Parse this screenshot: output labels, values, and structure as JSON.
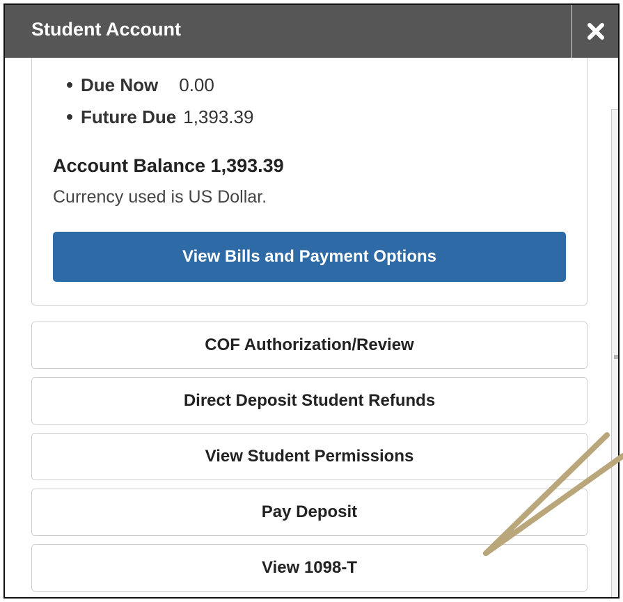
{
  "header": {
    "title": "Student Account",
    "close_icon": "close-icon"
  },
  "summary": {
    "items": [
      {
        "label": "Due Now",
        "value": "0.00"
      },
      {
        "label": "Future Due",
        "value": "1,393.39"
      }
    ],
    "account_balance": "Account Balance 1,393.39",
    "currency_note": "Currency used is US Dollar.",
    "primary_button": "View Bills and Payment Options"
  },
  "actions": [
    {
      "label": "COF Authorization/Review"
    },
    {
      "label": "Direct Deposit Student Refunds"
    },
    {
      "label": "View Student Permissions"
    },
    {
      "label": "Pay Deposit"
    },
    {
      "label": "View 1098-T"
    }
  ],
  "colors": {
    "titlebar": "#565656",
    "primary_button": "#2e6aa6",
    "annotation_arrow": "#b9a67a"
  }
}
